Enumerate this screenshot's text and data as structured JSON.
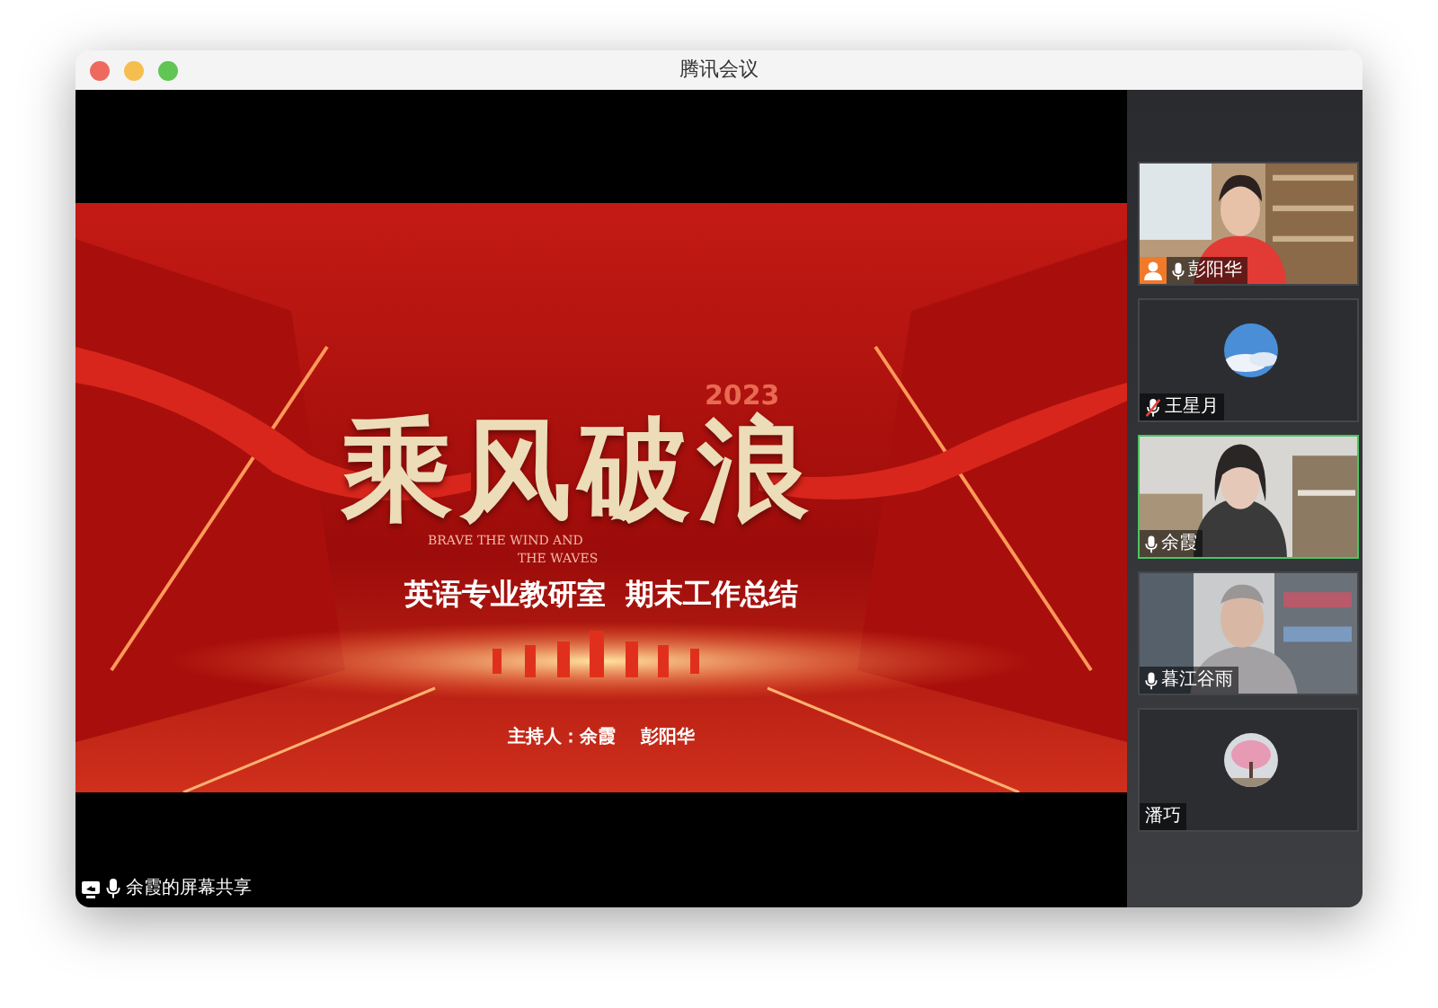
{
  "window": {
    "title": "腾讯会议"
  },
  "slide": {
    "year": "2023",
    "title": "乘风破浪",
    "english": [
      "BRAVE THE WIND AND",
      "THE WAVES"
    ],
    "subtitle": "英语专业教研室  期末工作总结",
    "hosts": "主持人：余霞    彭阳华"
  },
  "participants": [
    {
      "name": "彭阳华",
      "kind": "video",
      "mic_visible": true,
      "muted": false,
      "host": true,
      "selected": false
    },
    {
      "name": "王星月",
      "kind": "avatar",
      "mic_visible": true,
      "muted": true,
      "host": false,
      "selected": false
    },
    {
      "name": "余霞",
      "kind": "video",
      "mic_visible": true,
      "muted": false,
      "host": false,
      "selected": true
    },
    {
      "name": "暮江谷雨",
      "kind": "video",
      "mic_visible": true,
      "muted": false,
      "host": false,
      "selected": false
    },
    {
      "name": "潘巧",
      "kind": "avatar",
      "mic_visible": false,
      "host": false,
      "selected": false
    }
  ],
  "status_bar": {
    "label": "余霞的屏幕共享"
  }
}
